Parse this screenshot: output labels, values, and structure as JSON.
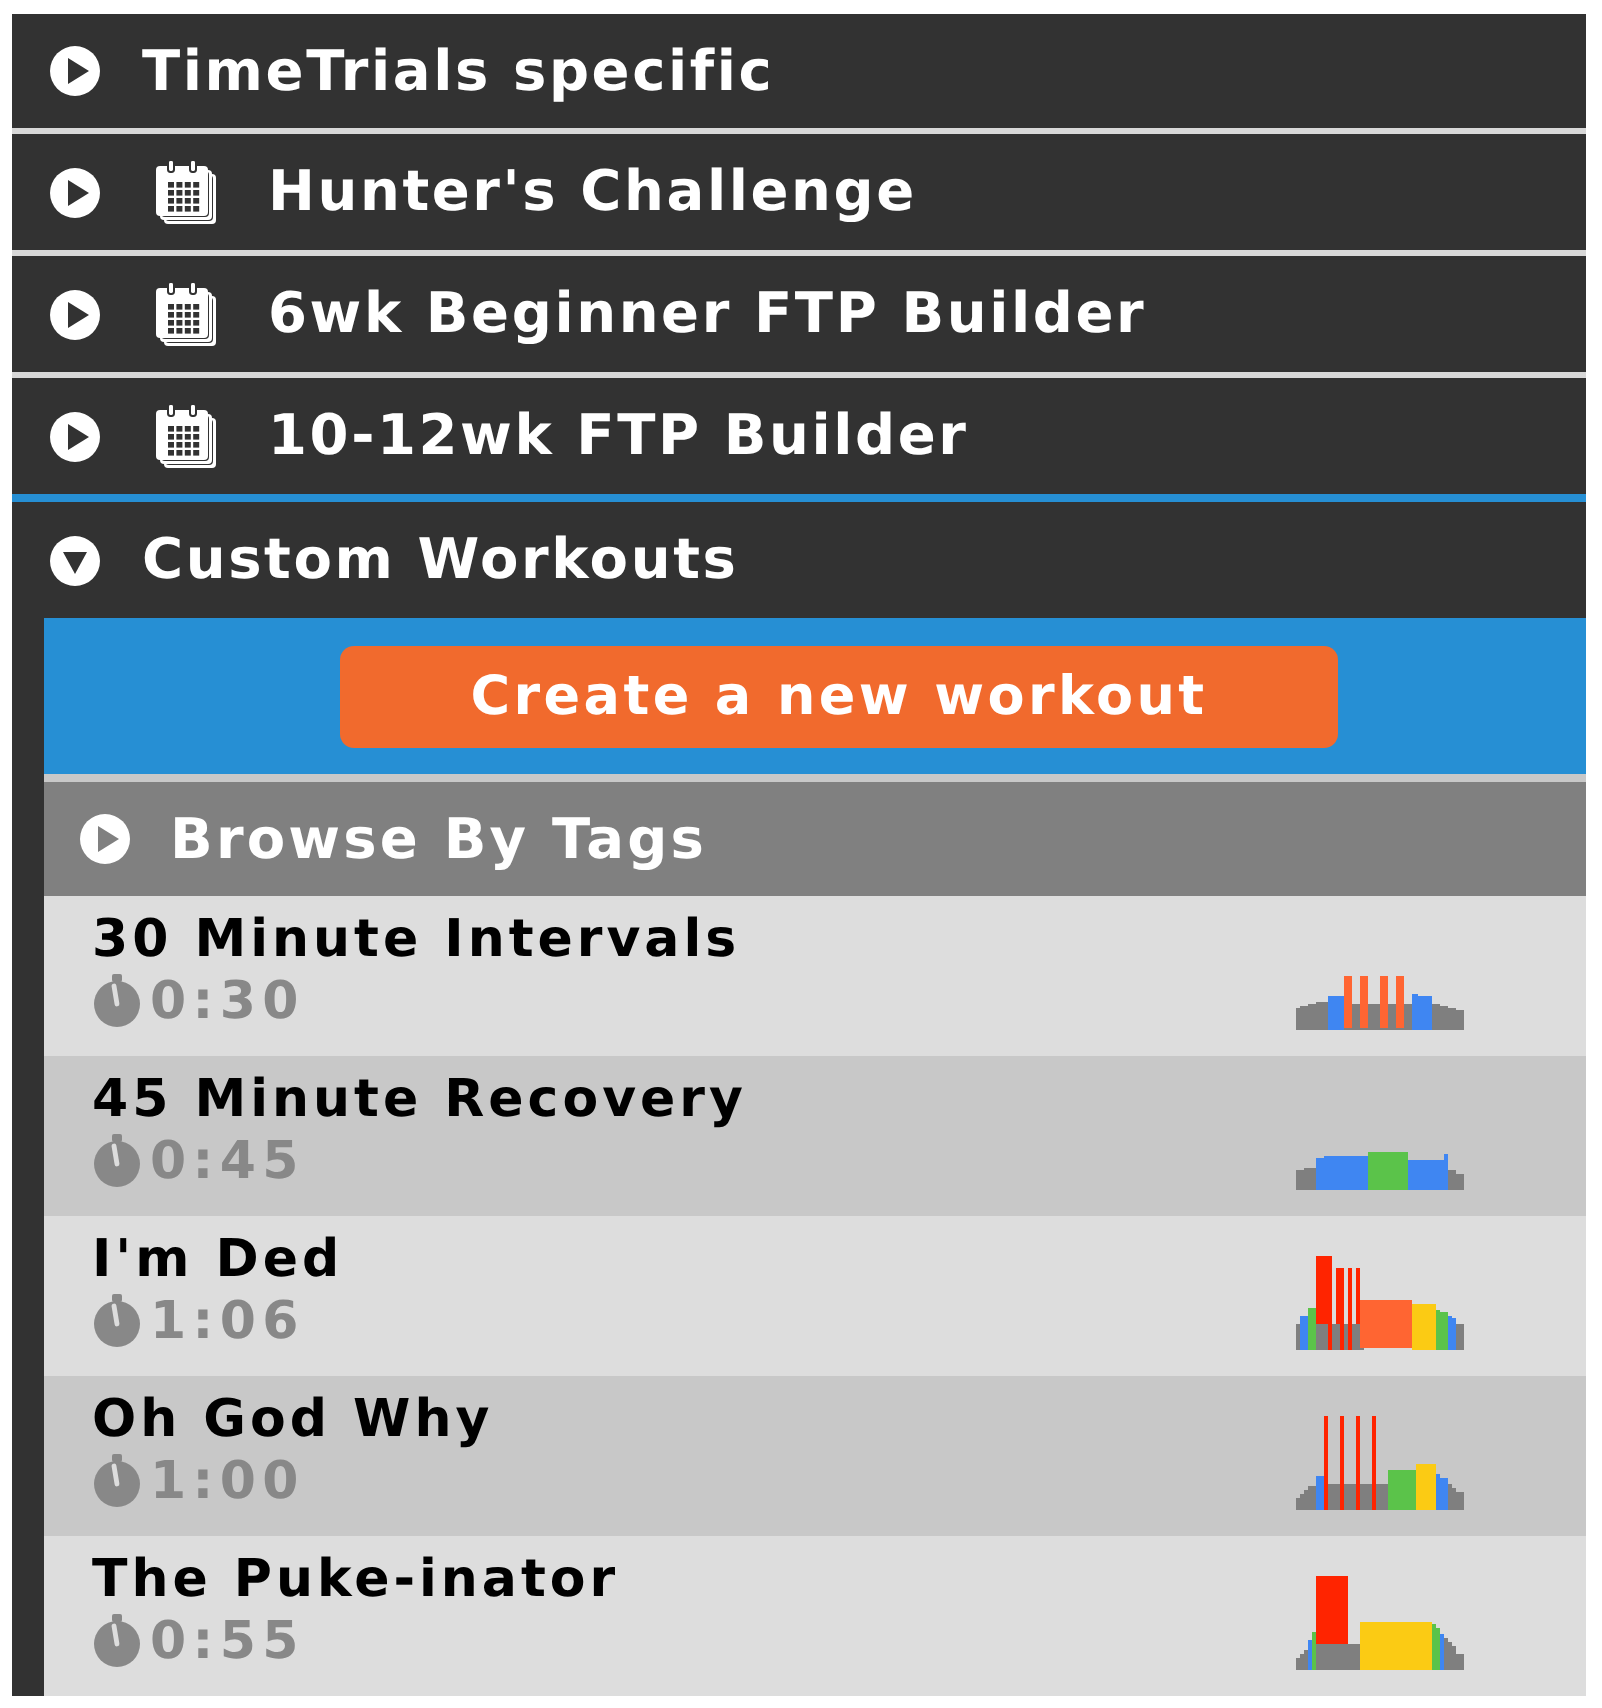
{
  "categories": [
    {
      "title": "TimeTrials specific",
      "kind": "folder",
      "expanded": false
    },
    {
      "title": "Hunter's Challenge",
      "kind": "plan",
      "expanded": false
    },
    {
      "title": "6wk Beginner FTP Builder",
      "kind": "plan",
      "expanded": false
    },
    {
      "title": "10-12wk FTP Builder",
      "kind": "plan",
      "expanded": false
    },
    {
      "title": "Custom Workouts",
      "kind": "folder",
      "expanded": true,
      "create_button": "Create a new workout",
      "groups": [
        {
          "title": "Browse By Tags",
          "expanded": false
        }
      ],
      "workouts": [
        {
          "name": "30 Minute Intervals",
          "duration": "0:30"
        },
        {
          "name": "45 Minute Recovery",
          "duration": "0:45"
        },
        {
          "name": "I'm Ded",
          "duration": "1:06"
        },
        {
          "name": "Oh God Why",
          "duration": "1:00"
        },
        {
          "name": "The Puke-inator",
          "duration": "0:55"
        }
      ]
    }
  ]
}
